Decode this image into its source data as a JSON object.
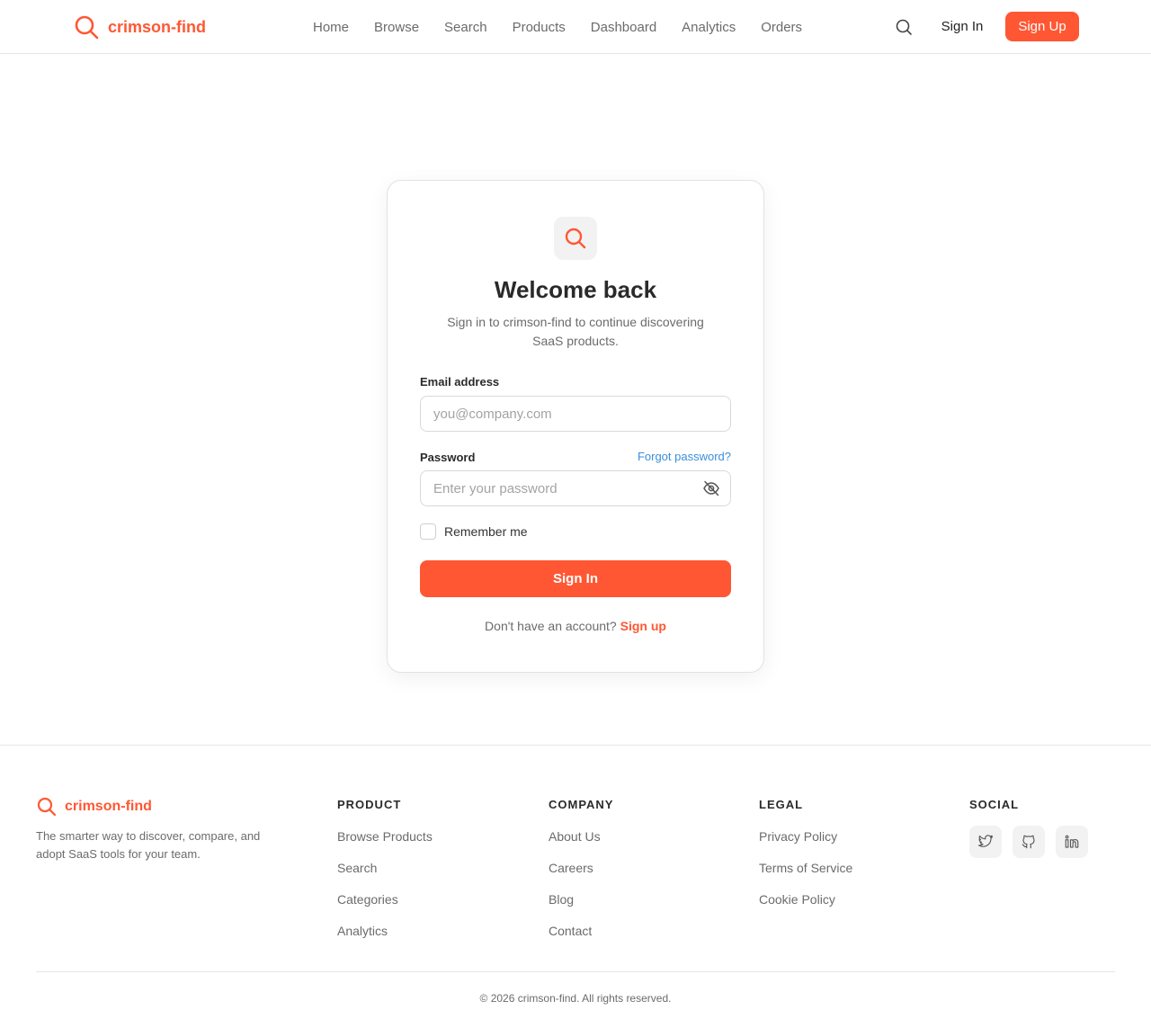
{
  "brand": {
    "name": "crimson-find",
    "icon": "search-icon",
    "color": "#ff5733"
  },
  "nav": {
    "items": [
      "Home",
      "Browse",
      "Search",
      "Products",
      "Dashboard",
      "Analytics",
      "Orders"
    ],
    "search_icon": "search-icon",
    "sign_in": "Sign In",
    "sign_up": "Sign Up"
  },
  "login": {
    "icon": "search-icon",
    "title": "Welcome back",
    "subtitle": "Sign in to crimson-find to continue discovering SaaS products.",
    "email_label": "Email address",
    "email_placeholder": "you@company.com",
    "email_value": "",
    "password_label": "Password",
    "forgot_label": "Forgot password?",
    "password_placeholder": "Enter your password",
    "password_value": "",
    "password_toggle_icon": "eye-off-icon",
    "remember_label": "Remember me",
    "remember_checked": false,
    "submit_label": "Sign In",
    "no_account_text": "Don't have an account?",
    "signup_link": "Sign up"
  },
  "footer": {
    "brand": "crimson-find",
    "tagline": "The smarter way to discover, compare, and adopt SaaS tools for your team.",
    "columns": [
      {
        "heading": "PRODUCT",
        "links": [
          "Browse Products",
          "Search",
          "Categories",
          "Analytics"
        ]
      },
      {
        "heading": "COMPANY",
        "links": [
          "About Us",
          "Careers",
          "Blog",
          "Contact"
        ]
      },
      {
        "heading": "LEGAL",
        "links": [
          "Privacy Policy",
          "Terms of Service",
          "Cookie Policy"
        ]
      }
    ],
    "social_heading": "SOCIAL",
    "social_icons": [
      "twitter-icon",
      "github-icon",
      "linkedin-icon"
    ],
    "copyright": "© 2026 crimson-find. All rights reserved."
  },
  "colors": {
    "accent": "#ff5733",
    "link": "#3b8fdb",
    "muted_text": "#6b6b6b",
    "border": "#e5e5e5"
  }
}
